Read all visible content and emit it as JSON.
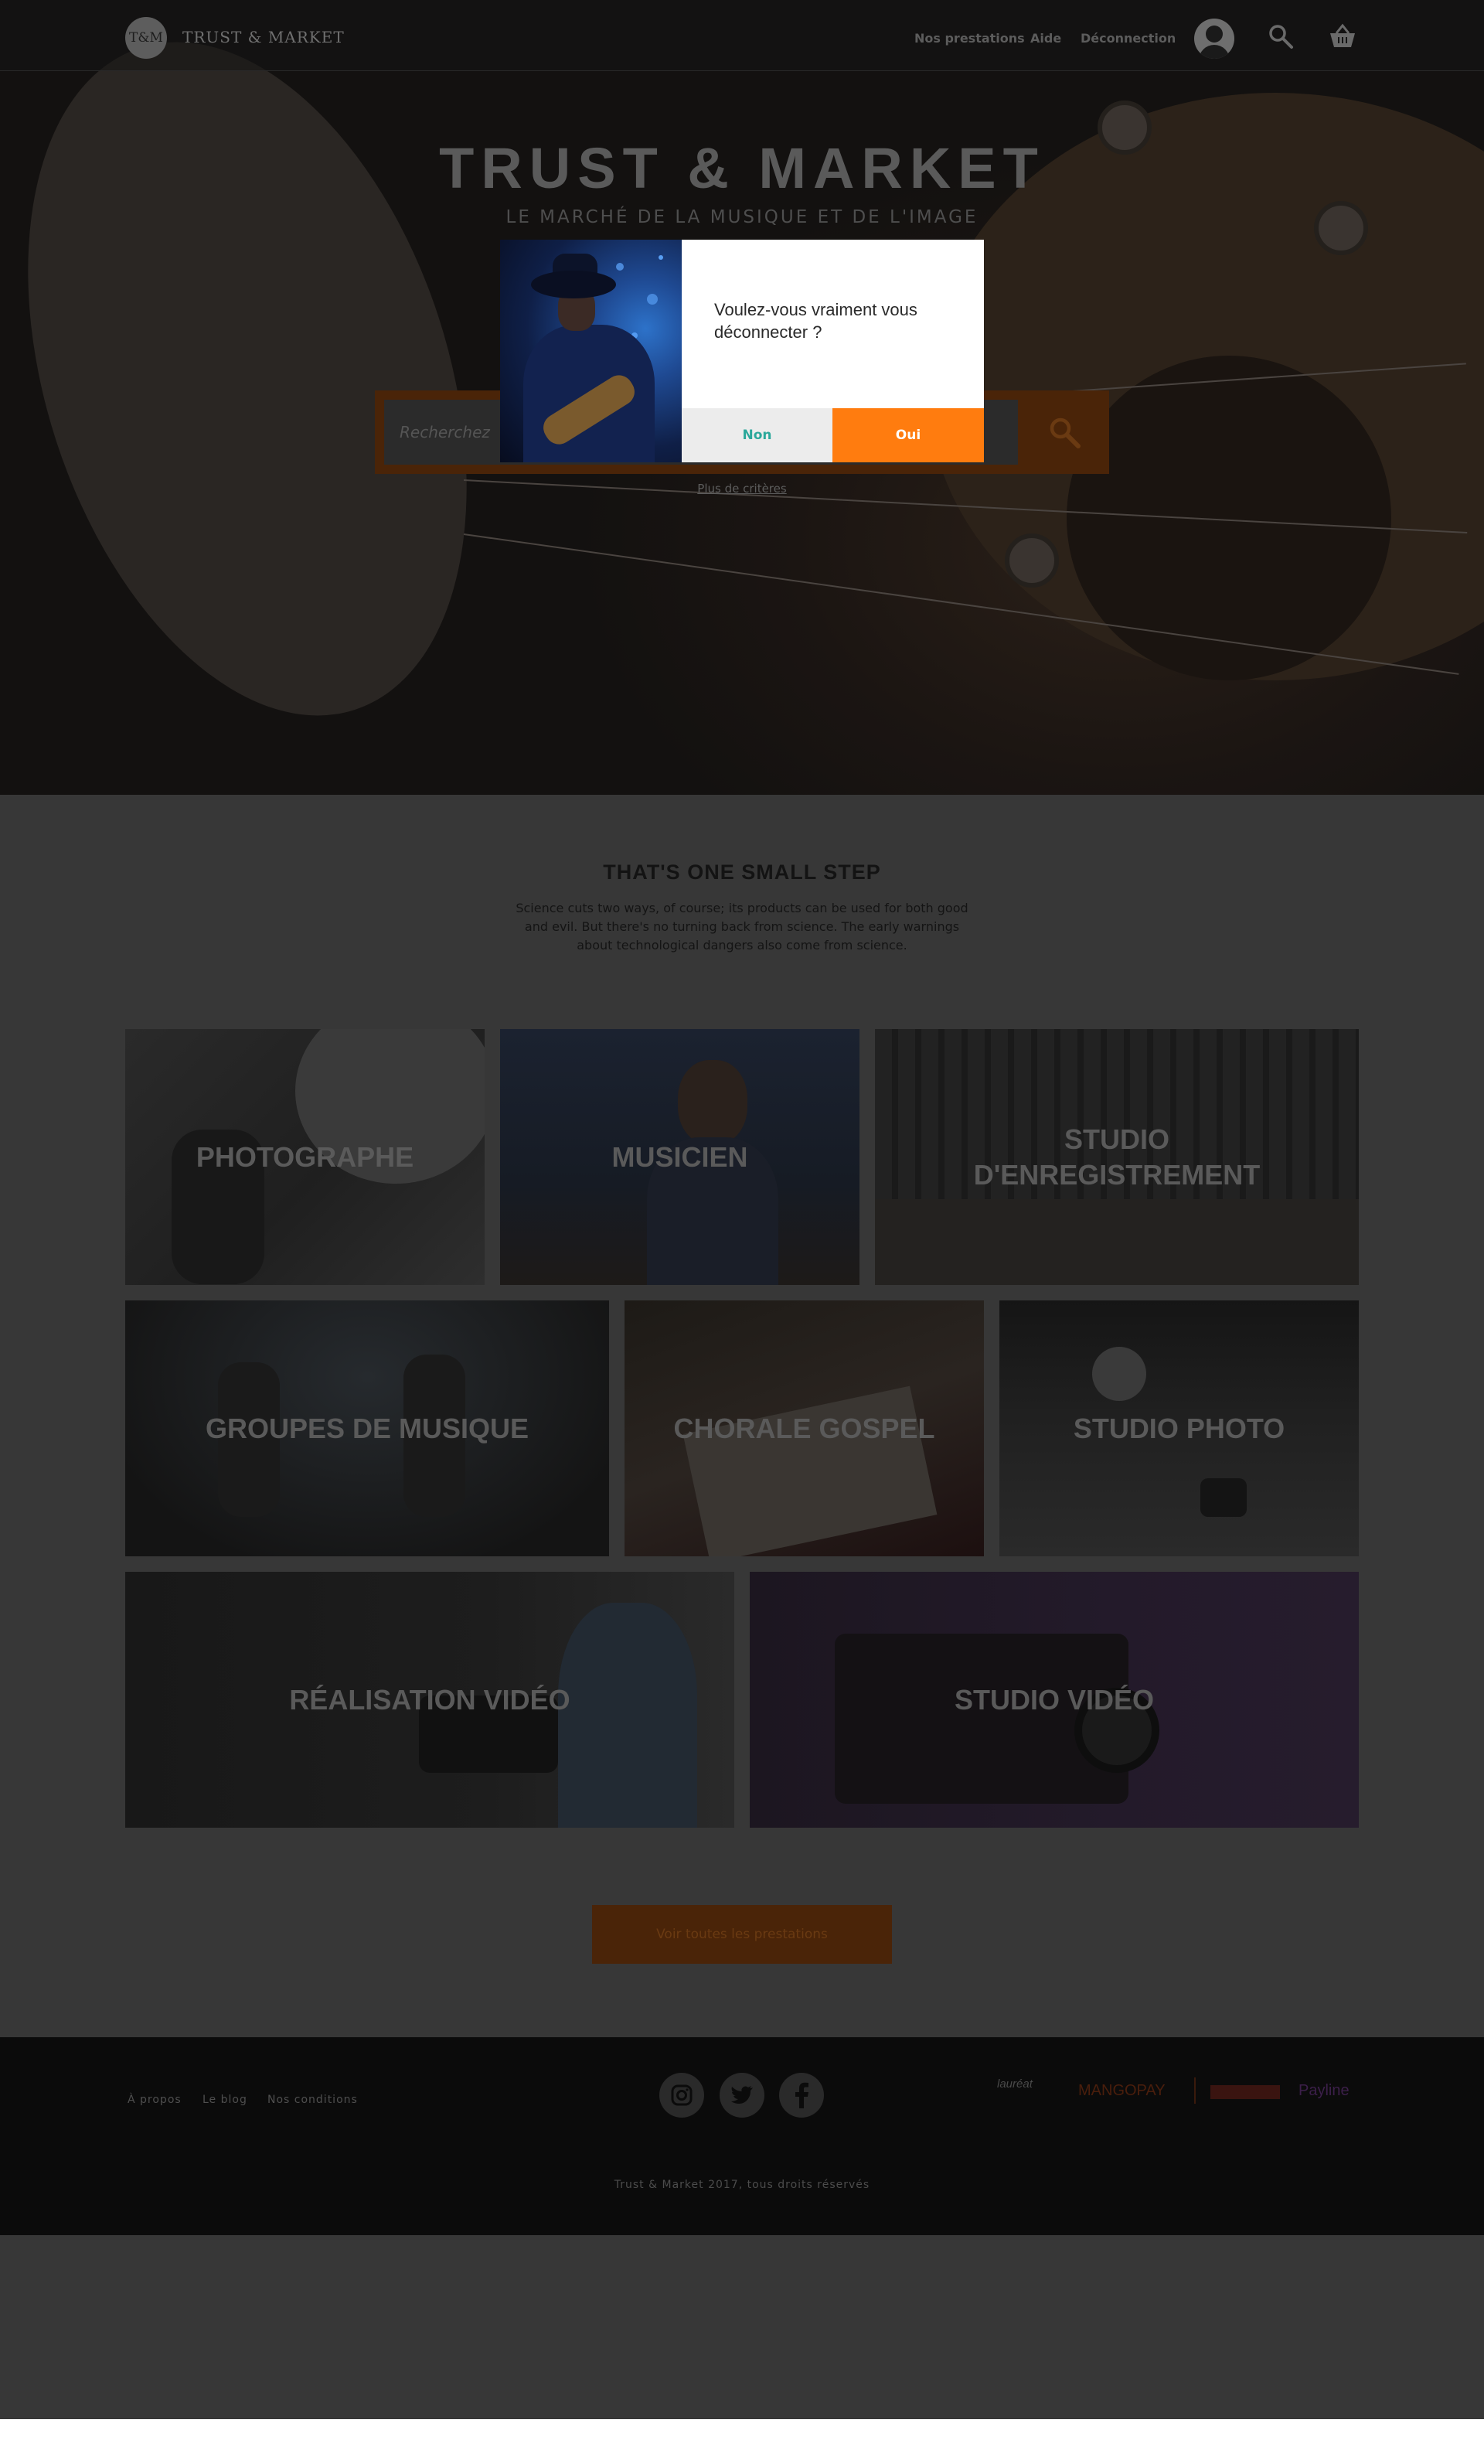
{
  "brand": {
    "logo_initials": "T&M",
    "name": "TRUST & MARKET"
  },
  "nav": {
    "links": [
      "Nos prestations",
      "Aide",
      "Déconnection"
    ]
  },
  "hero": {
    "title": "TRUST & MARKET",
    "subtitle": "LE MARCHÉ DE LA MUSIQUE ET DE L'IMAGE",
    "search_placeholder": "Recherchez",
    "more_criteria": "Plus de critères"
  },
  "modal": {
    "message": "Voulez-vous vraiment vous déconnecter ?",
    "no_label": "Non",
    "yes_label": "Oui"
  },
  "section": {
    "title": "THAT'S ONE SMALL STEP",
    "text": "Science cuts two ways, of course; its products can be used for both good and evil. But there's no turning back from science. The early warnings about technological dangers also come from science."
  },
  "categories": [
    "PHOTOGRAPHE",
    "MUSICIEN",
    "STUDIO\nD'ENREGISTREMENT",
    "GROUPES DE MUSIQUE",
    "CHORALE GOSPEL",
    "STUDIO PHOTO",
    "RÉALISATION VIDÉO",
    "STUDIO VIDÉO"
  ],
  "cta_label": "Voir toutes les prestations",
  "footer": {
    "links": [
      "À propos",
      "Le blog",
      "Nos conditions"
    ],
    "social": [
      "instagram-icon",
      "twitter-icon",
      "facebook-icon"
    ],
    "partners": [
      "lauréat",
      "MANGOPAY",
      "Payline"
    ],
    "copyright": "Trust & Market 2017, tous droits réservés"
  },
  "colors": {
    "accent": "#ff7c0f",
    "no_text": "#2ba89b",
    "overlay_accent": "#4a2408"
  }
}
